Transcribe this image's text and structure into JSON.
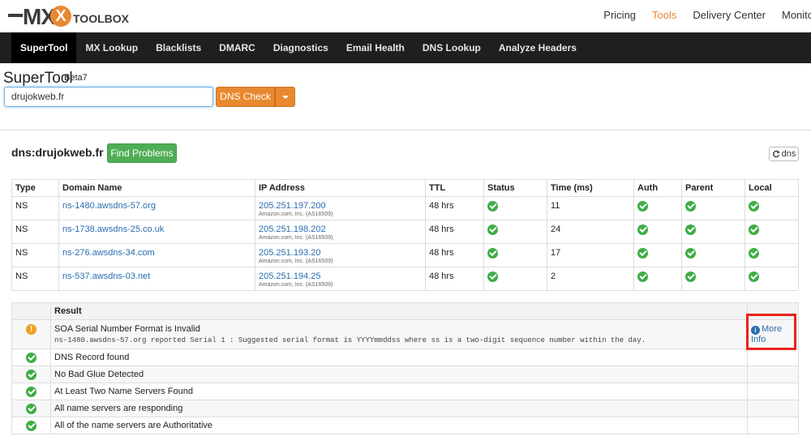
{
  "header": {
    "logo_mx": "MX",
    "logo_toolbox": "TOOLBOX",
    "links": [
      "Pricing",
      "Tools",
      "Delivery Center",
      "Monitoring"
    ],
    "active_link": "Tools"
  },
  "nav": {
    "items": [
      "SuperTool",
      "MX Lookup",
      "Blacklists",
      "DMARC",
      "Diagnostics",
      "Email Health",
      "DNS Lookup",
      "Analyze Headers"
    ]
  },
  "supertool": {
    "title": "SuperTool",
    "beta": "Beta7",
    "search_value": "drujokweb.fr",
    "button_label": "DNS Check"
  },
  "result_header": {
    "title": "dns:drujokweb.fr",
    "find_problems": "Find Problems",
    "refresh_label": "dns"
  },
  "dns_table": {
    "columns": [
      "Type",
      "Domain Name",
      "IP Address",
      "TTL",
      "Status",
      "Time (ms)",
      "Auth",
      "Parent",
      "Local"
    ],
    "rows": [
      {
        "type": "NS",
        "domain": "ns-1480.awsdns-57.org",
        "ip": "205.251.197.200",
        "asn": "Amazon.com, Inc. (AS16509)",
        "ttl": "48 hrs",
        "time": "11"
      },
      {
        "type": "NS",
        "domain": "ns-1738.awsdns-25.co.uk",
        "ip": "205.251.198.202",
        "asn": "Amazon.com, Inc. (AS16509)",
        "ttl": "48 hrs",
        "time": "24"
      },
      {
        "type": "NS",
        "domain": "ns-276.awsdns-34.com",
        "ip": "205.251.193.20",
        "asn": "Amazon.com, Inc. (AS16509)",
        "ttl": "48 hrs",
        "time": "17"
      },
      {
        "type": "NS",
        "domain": "ns-537.awsdns-03.net",
        "ip": "205.251.194.25",
        "asn": "Amazon.com, Inc. (AS16509)",
        "ttl": "48 hrs",
        "time": "2"
      }
    ]
  },
  "results_table": {
    "header": "Result",
    "warning": {
      "title": "SOA Serial Number Format is Invalid",
      "detail": "ns-1480.awsdns-57.org reported Serial 1 : Suggested serial format is YYYYmmddss where ss is a two-digit sequence number within the day.",
      "more_info_line1": "More",
      "more_info_line2": "Info"
    },
    "passes": [
      "DNS Record found",
      "No Bad Glue Detected",
      "At Least Two Name Servers Found",
      "All name servers are responding",
      "All of the name servers are Authoritative"
    ]
  },
  "colors": {
    "accent": "#e8892f",
    "success": "#4fae55",
    "nav_bg": "#1f1f1f",
    "link": "#2a6db0",
    "highlight": "#e8221c"
  }
}
